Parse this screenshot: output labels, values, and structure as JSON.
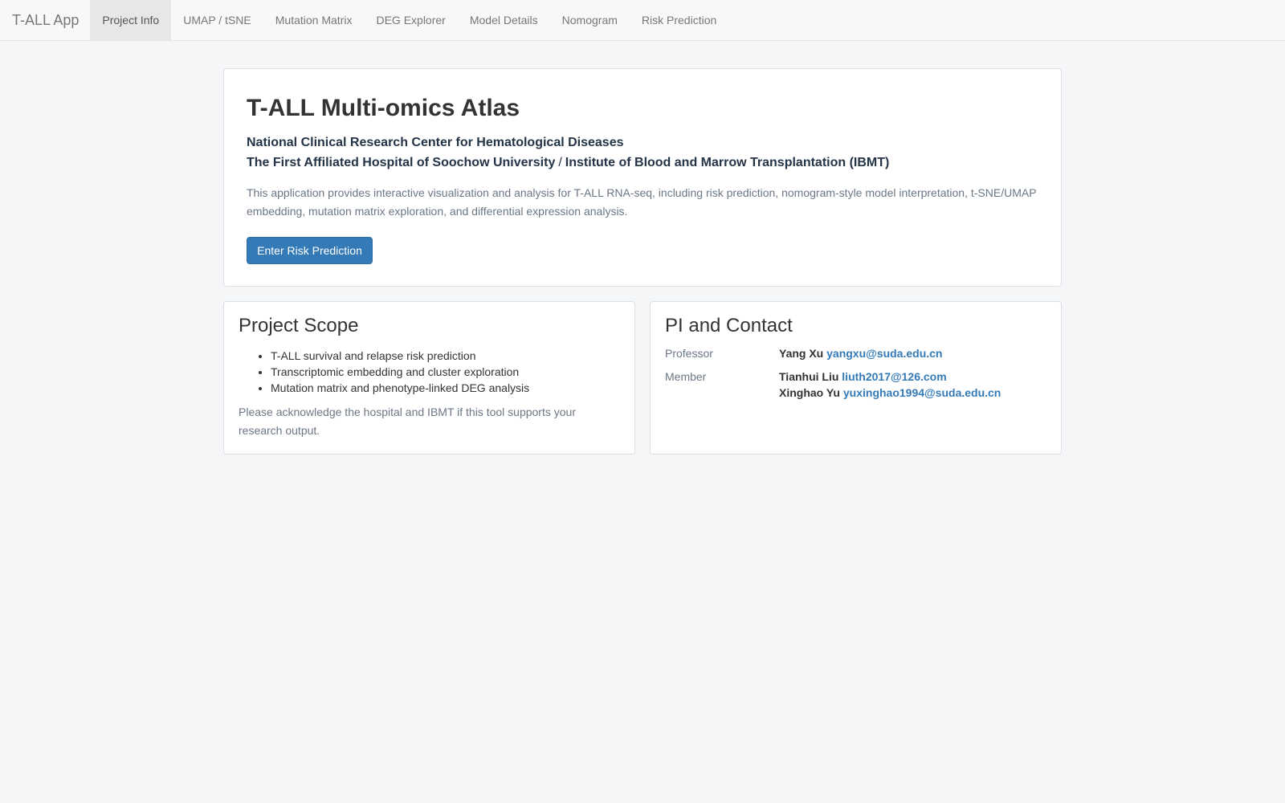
{
  "navbar": {
    "brand": "T-ALL App",
    "tabs": [
      {
        "label": "Project Info",
        "active": true
      },
      {
        "label": "UMAP / tSNE",
        "active": false
      },
      {
        "label": "Mutation Matrix",
        "active": false
      },
      {
        "label": "DEG Explorer",
        "active": false
      },
      {
        "label": "Model Details",
        "active": false
      },
      {
        "label": "Nomogram",
        "active": false
      },
      {
        "label": "Risk Prediction",
        "active": false
      }
    ]
  },
  "hero": {
    "title": "T-ALL Multi-omics Atlas",
    "institution_line1": "National Clinical Research Center for Hematological Diseases",
    "institution_line2_a": "The First Affiliated Hospital of Soochow University",
    "institution_line2_sep": "/",
    "institution_line2_b": "Institute of Blood and Marrow Transplantation (IBMT)",
    "description": "This application provides interactive visualization and analysis for T-ALL RNA-seq, including risk prediction, nomogram-style model interpretation, t-SNE/UMAP embedding, mutation matrix exploration, and differential expression analysis.",
    "cta_label": "Enter Risk Prediction"
  },
  "scope": {
    "heading": "Project Scope",
    "items": [
      "T-ALL survival and relapse risk prediction",
      "Transcriptomic embedding and cluster exploration",
      "Mutation matrix and phenotype-linked DEG analysis"
    ],
    "acknowledgement": "Please acknowledge the hospital and IBMT if this tool supports your research output."
  },
  "contact": {
    "heading": "PI and Contact",
    "professor_label": "Professor",
    "professor": {
      "name": "Yang Xu",
      "email": "yangxu@suda.edu.cn"
    },
    "member_label": "Member",
    "members": [
      {
        "name": "Tianhui Liu",
        "email": "liuth2017@126.com"
      },
      {
        "name": "Xinghao Yu",
        "email": "yuxinghao1994@suda.edu.cn"
      }
    ]
  },
  "colors": {
    "primary": "#337ab7",
    "page_background": "#f5f6f8",
    "navbar_background": "#f8f8f8",
    "active_tab_background": "#e7e7e7"
  }
}
